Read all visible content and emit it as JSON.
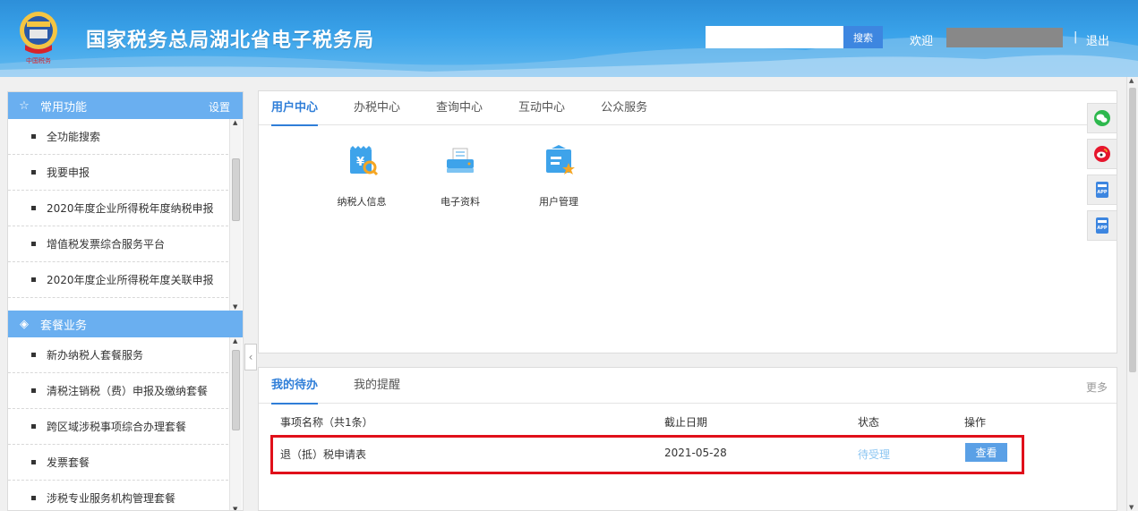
{
  "header": {
    "title": "国家税务总局湖北省电子税务局",
    "search_placeholder": "",
    "search_button": "搜索",
    "welcome": "欢迎",
    "separator": "|",
    "logout": "退出"
  },
  "sidebar": {
    "common": {
      "title": "常用功能",
      "settings": "设置",
      "items": [
        {
          "label": "全功能搜索"
        },
        {
          "label": "我要申报"
        },
        {
          "label": "2020年度企业所得税年度纳税申报"
        },
        {
          "label": "增值税发票综合服务平台"
        },
        {
          "label": "2020年度企业所得税年度关联申报"
        }
      ]
    },
    "package": {
      "title": "套餐业务",
      "items": [
        {
          "label": "新办纳税人套餐服务"
        },
        {
          "label": "清税注销税（费）申报及缴纳套餐"
        },
        {
          "label": "跨区域涉税事项综合办理套餐"
        },
        {
          "label": "发票套餐"
        },
        {
          "label": "涉税专业服务机构管理套餐"
        }
      ]
    }
  },
  "main": {
    "tabs": [
      {
        "label": "用户中心",
        "active": true
      },
      {
        "label": "办税中心"
      },
      {
        "label": "查询中心"
      },
      {
        "label": "互动中心"
      },
      {
        "label": "公众服务"
      }
    ],
    "apps": [
      {
        "label": "纳税人信息",
        "icon": "taxpayer-info-icon"
      },
      {
        "label": "电子资料",
        "icon": "e-documents-icon"
      },
      {
        "label": "用户管理",
        "icon": "user-management-icon"
      }
    ]
  },
  "todo": {
    "tabs": [
      {
        "label": "我的待办",
        "active": true
      },
      {
        "label": "我的提醒"
      }
    ],
    "more": "更多",
    "columns": {
      "name": "事项名称（共1条）",
      "deadline": "截止日期",
      "status": "状态",
      "action": "操作"
    },
    "rows": [
      {
        "name": "退（抵）税申请表",
        "deadline": "2021-05-28",
        "status": "待受理",
        "action": "查看"
      }
    ]
  },
  "float_bar": [
    "wechat-icon",
    "weibo-icon",
    "app-icon",
    "app-icon"
  ],
  "colors": {
    "header": "#3aa3ea",
    "sidebar_head": "#6aaff0",
    "accent": "#2f7ed8",
    "highlight": "#e0101a"
  }
}
